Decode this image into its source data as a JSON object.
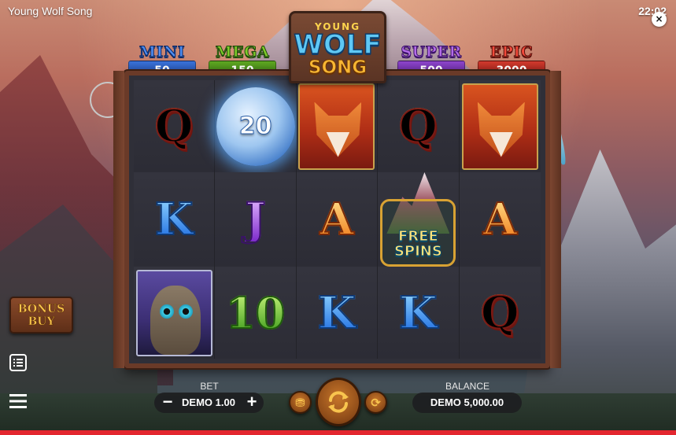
{
  "window": {
    "title": "Young Wolf Song",
    "clock": "22:02",
    "close_glyph": "×"
  },
  "logo": {
    "line1": "YOUNG",
    "line2": "WOLF",
    "line3": "SONG"
  },
  "jackpots": [
    {
      "name": "MINI",
      "value": "50",
      "color": "#3a72d9"
    },
    {
      "name": "MEGA",
      "value": "150",
      "color": "#5fa822"
    },
    {
      "name": "SUPER",
      "value": "500",
      "color": "#8e45cc"
    },
    {
      "name": "EPIC",
      "value": "3000",
      "color": "#d23a2e"
    }
  ],
  "reels": {
    "rows": [
      [
        "Q",
        "moon-20",
        "fox",
        "Q",
        "fox"
      ],
      [
        "K",
        "J",
        "A",
        "free-spins",
        "A"
      ],
      [
        "owl",
        "10",
        "K",
        "K",
        "Q"
      ]
    ],
    "moon_value": "20",
    "free_spins_text": "FREE SPINS"
  },
  "controls": {
    "bonus_buy_label": "BONUS BUY",
    "bet_label": "BET",
    "bet_value": "DEMO 1.00",
    "bet_minus": "−",
    "bet_plus": "+",
    "balance_label": "BALANCE",
    "balance_value": "DEMO 5,000.00",
    "spin_icon": "spin-arrows-icon",
    "autoplay_icon": "coin-stack-icon",
    "turbo_icon": "turbo-icon",
    "paytable_icon": "list-icon",
    "menu_icon": "hamburger-icon"
  },
  "colors": {
    "accent_red": "#e3262f",
    "wood": "#6a3a28",
    "gold": "#f8c44e"
  }
}
